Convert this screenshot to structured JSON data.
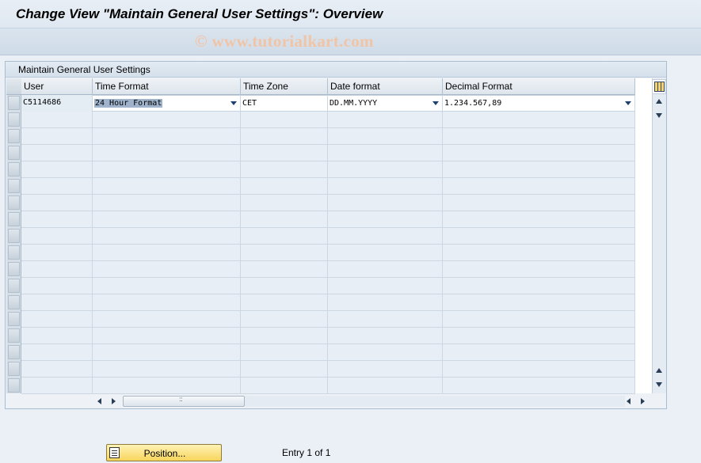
{
  "window": {
    "title": "Change View \"Maintain General User Settings\": Overview",
    "watermark": "© www.tutorialkart.com"
  },
  "group": {
    "title": "Maintain General User Settings"
  },
  "table": {
    "columns": [
      "User",
      "Time Format",
      "Time Zone",
      "Date format",
      "Decimal Format"
    ],
    "rows": [
      {
        "user": "C5114686",
        "time_format": "24 Hour Format",
        "time_zone": "CET",
        "date_format": "DD.MM.YYYY",
        "decimal_format": "1.234.567,89"
      }
    ]
  },
  "footer": {
    "position_button": "Position...",
    "entry_info": "Entry 1 of 1"
  },
  "icons": {
    "column_settings": "column-settings-icon",
    "scroll_up": "scroll-up-icon",
    "scroll_down": "scroll-down-icon",
    "position": "position-icon"
  }
}
